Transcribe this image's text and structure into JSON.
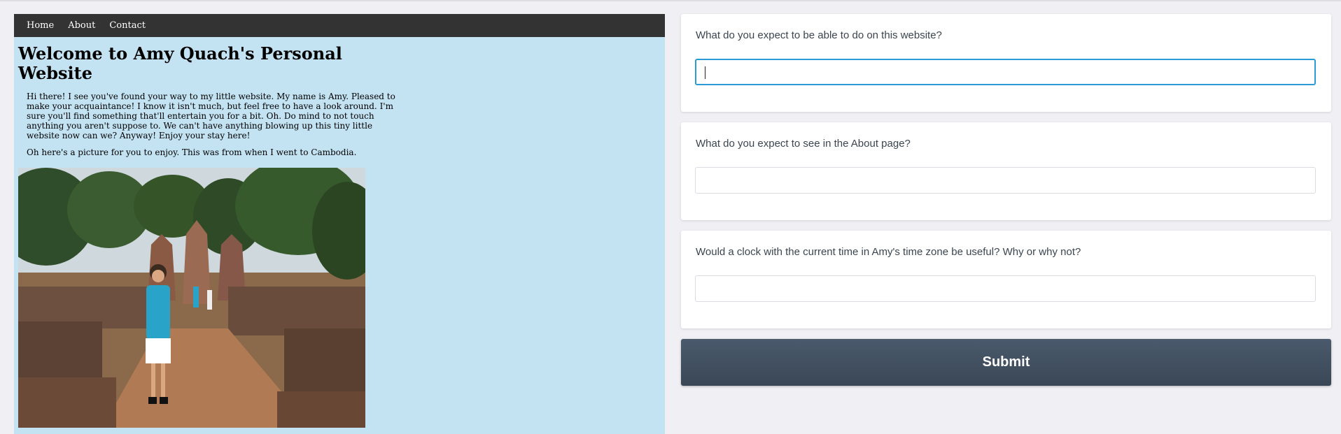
{
  "site": {
    "nav": [
      "Home",
      "About",
      "Contact"
    ],
    "title": "Welcome to Amy Quach's Personal Website",
    "intro": "Hi there! I see you've found your way to my little website. My name is Amy. Pleased to make your acquaintance! I know it isn't much, but feel free to have a look around. I'm sure you'll find something that'll entertain you for a bit. Oh. Do mind to not touch anything you aren't suppose to. We can't have anything blowing up this tiny little website now can we? Anyway! Enjoy your stay here!",
    "photo_caption": "Oh here's a picture for you to enjoy. This was from when I went to Cambodia."
  },
  "survey": {
    "questions": [
      {
        "label": "What do you expect to be able to do on this website?",
        "value": ""
      },
      {
        "label": "What do you expect to see in the About page?",
        "value": ""
      },
      {
        "label": "Would a clock with the current time in Amy's time zone be useful? Why or why not?",
        "value": ""
      }
    ],
    "submit_label": "Submit"
  },
  "colors": {
    "preview_bg": "#c3e2f2",
    "nav_bg": "#333333",
    "focus_border": "#2a9bd4",
    "submit_bg": "#435162"
  }
}
